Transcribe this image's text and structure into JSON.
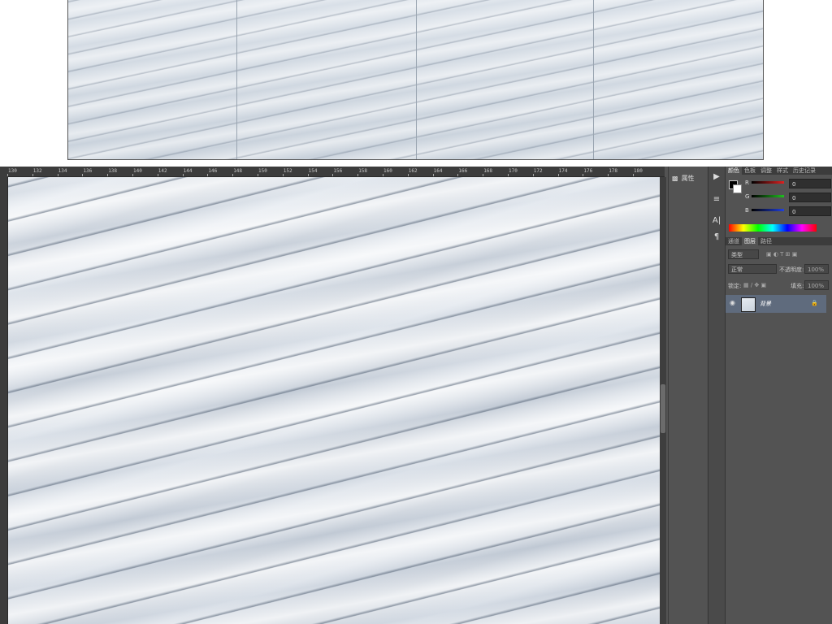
{
  "ruler": {
    "ticks": [
      "130",
      "132",
      "134",
      "136",
      "138",
      "140",
      "142",
      "144",
      "146",
      "148",
      "150",
      "152",
      "154",
      "156",
      "158",
      "160",
      "162",
      "164",
      "166",
      "168",
      "170",
      "172",
      "174",
      "176",
      "178",
      "180"
    ]
  },
  "properties_panel": {
    "label": "属性"
  },
  "color_panel": {
    "tabs": [
      "颜色",
      "色板",
      "调整",
      "样式",
      "历史记录"
    ],
    "rows": [
      {
        "label": "R",
        "value": "0",
        "color": "#e02020"
      },
      {
        "label": "G",
        "value": "0",
        "color": "#20c020"
      },
      {
        "label": "B",
        "value": "0",
        "color": "#2040e0"
      }
    ]
  },
  "layers_panel": {
    "tabs": [
      "通道",
      "图层",
      "路径"
    ],
    "filter_kind": "类型",
    "blend_mode": "正常",
    "opacity_label": "不透明度:",
    "opacity_value": "100%",
    "lock_label": "锁定:",
    "fill_label": "填充:",
    "fill_value": "100%",
    "layers": [
      {
        "name": "背景"
      }
    ]
  },
  "colors": {
    "panel_bg": "#535353",
    "ruler_bg": "#3c3c3c",
    "selected_layer": "#5f6b7d"
  }
}
